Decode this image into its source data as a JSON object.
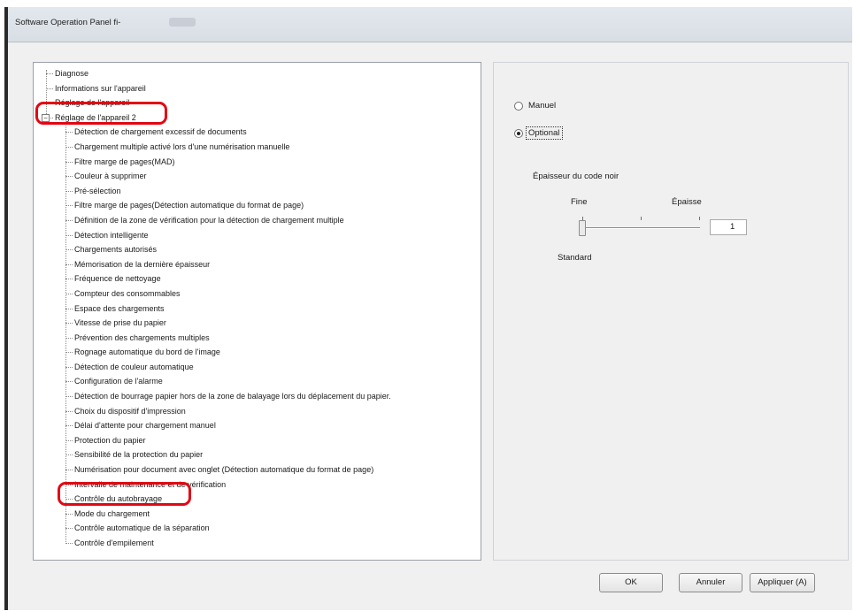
{
  "window": {
    "title": "Software Operation Panel fi-"
  },
  "tree": {
    "items": [
      {
        "label": "Diagnose",
        "level": 0
      },
      {
        "label": "Informations sur l'appareil",
        "level": 0
      },
      {
        "label": "Réglage de l'appareil",
        "level": 0
      },
      {
        "label": "Réglage de l'appareil 2",
        "level": 0,
        "expander": "⊟"
      },
      {
        "label": "Détection de chargement excessif de documents",
        "level": 1
      },
      {
        "label": "Chargement multiple activé lors d'une numérisation manuelle",
        "level": 1
      },
      {
        "label": "Filtre marge de pages(MAD)",
        "level": 1
      },
      {
        "label": "Couleur à supprimer",
        "level": 1
      },
      {
        "label": "Pré-sélection",
        "level": 1
      },
      {
        "label": "Filtre marge de pages(Détection automatique du format de page)",
        "level": 1
      },
      {
        "label": "Définition de la zone de vérification pour la détection de chargement multiple",
        "level": 1
      },
      {
        "label": "Détection intelligente",
        "level": 1
      },
      {
        "label": "Chargements autorisés",
        "level": 1
      },
      {
        "label": "Mémorisation de la dernière épaisseur",
        "level": 1
      },
      {
        "label": "Fréquence de nettoyage",
        "level": 1
      },
      {
        "label": "Compteur des consommables",
        "level": 1
      },
      {
        "label": "Espace des chargements",
        "level": 1
      },
      {
        "label": "Vitesse de prise du papier",
        "level": 1
      },
      {
        "label": "Prévention des chargements multiples",
        "level": 1
      },
      {
        "label": "Rognage automatique du bord de l'image",
        "level": 1
      },
      {
        "label": "Détection de couleur automatique",
        "level": 1
      },
      {
        "label": "Configuration de l'alarme",
        "level": 1
      },
      {
        "label": "Détection de bourrage papier hors de la zone de balayage lors du déplacement du papier.",
        "level": 1
      },
      {
        "label": "Choix du dispositif d'impression",
        "level": 1
      },
      {
        "label": "Délai d'attente pour chargement manuel",
        "level": 1
      },
      {
        "label": "Protection du papier",
        "level": 1
      },
      {
        "label": "Sensibilité de la protection du papier",
        "level": 1
      },
      {
        "label": "Numérisation pour document avec onglet (Détection automatique du format de page)",
        "level": 1
      },
      {
        "label": "Intervalle de maintenance et de vérification",
        "level": 1
      },
      {
        "label": "Contrôle du autobrayage",
        "level": 1
      },
      {
        "label": "Mode du chargement",
        "level": 1
      },
      {
        "label": "Contrôle automatique de la séparation",
        "level": 1
      },
      {
        "label": "Contrôle d'empilement",
        "level": 1
      }
    ]
  },
  "settings": {
    "option_manual": "Manuel",
    "option_optional": "Optional",
    "group_label": "Épaisseur du code noir",
    "slider_min_label": "Fine",
    "slider_max_label": "Épaisse",
    "slider_value": "1",
    "slider_level": 0,
    "standard_label": "Standard"
  },
  "buttons": {
    "ok": "OK",
    "cancel": "Annuler",
    "apply": "Appliquer (A)"
  },
  "colors": {
    "highlight": "#e30613",
    "window_bg": "#f0f0f0"
  }
}
